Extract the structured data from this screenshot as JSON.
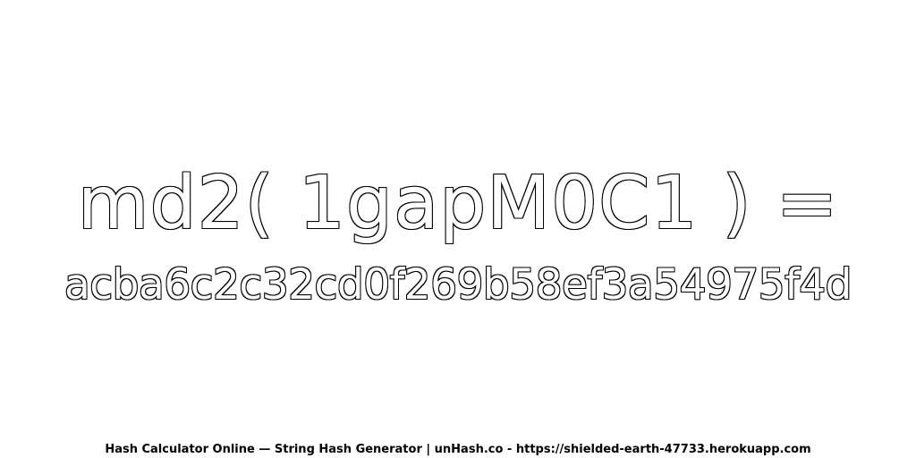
{
  "main": {
    "expression": "md2( 1gapM0C1 ) =",
    "hash_value": "acba6c2c32cd0f269b58ef3a54975f4d"
  },
  "footer": {
    "text": "Hash Calculator Online — String Hash Generator | unHash.co - https://shielded-earth-47733.herokuapp.com"
  }
}
